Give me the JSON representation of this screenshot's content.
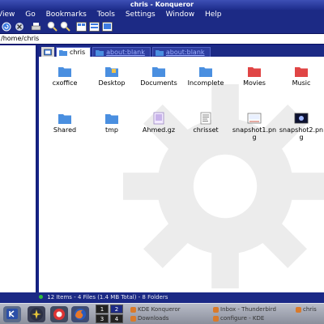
{
  "window": {
    "title": "chris - Konqueror"
  },
  "menu": [
    "View",
    "Go",
    "Bookmarks",
    "Tools",
    "Settings",
    "Window",
    "Help"
  ],
  "location": {
    "value": "/home/chris"
  },
  "tabs": [
    {
      "label": "chris",
      "active": true
    },
    {
      "label": "about:blank",
      "active": false
    },
    {
      "label": "about:blank",
      "active": false
    }
  ],
  "files": [
    {
      "name": "cxoffice",
      "type": "folder"
    },
    {
      "name": "Desktop",
      "type": "desktop-folder"
    },
    {
      "name": "Documents",
      "type": "folder"
    },
    {
      "name": "Incomplete",
      "type": "folder"
    },
    {
      "name": "Movies",
      "type": "folder-red"
    },
    {
      "name": "Music",
      "type": "folder-red"
    },
    {
      "name": "Shared",
      "type": "folder"
    },
    {
      "name": "tmp",
      "type": "folder"
    },
    {
      "name": "Ahmed.gz",
      "type": "archive"
    },
    {
      "name": "chrisset",
      "type": "text-file"
    },
    {
      "name": "snapshot1.png",
      "type": "image"
    },
    {
      "name": "snapshot2.png",
      "type": "image-dark"
    }
  ],
  "status": {
    "text": "12 Items - 4 Files (1.4 MB Total) - 8 Folders"
  },
  "taskbar": {
    "pager": [
      "1",
      "2",
      "3",
      "4"
    ],
    "tasks": [
      {
        "label": "KDE Konqueror"
      },
      {
        "label": "Inbox - Thunderbird"
      },
      {
        "label": "chris"
      },
      {
        "label": "Downloads"
      },
      {
        "label": "configure - KDE"
      }
    ]
  },
  "colors": {
    "accent": "#1c2a85",
    "title": "#2d3da0",
    "folder": "#4a8fe0",
    "folder_red": "#e04545"
  }
}
